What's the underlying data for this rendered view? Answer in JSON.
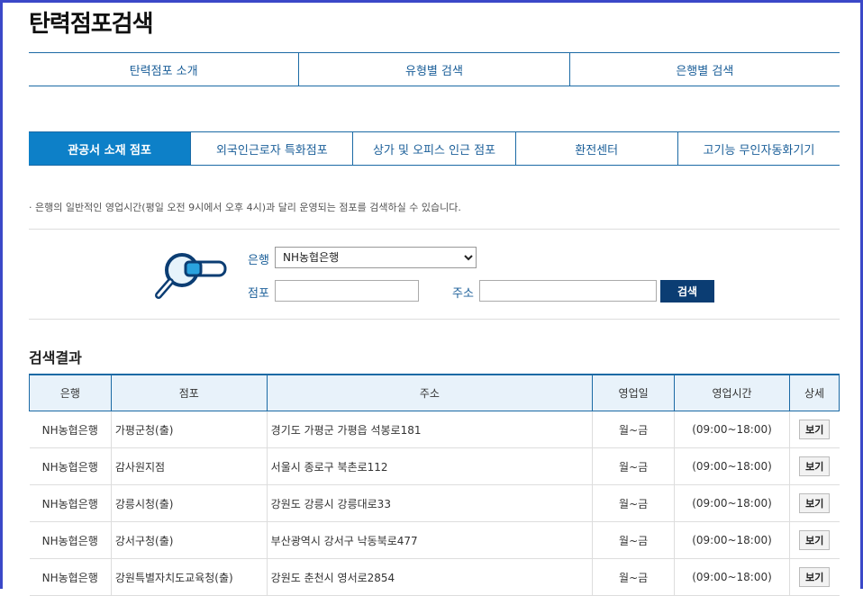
{
  "page": {
    "title": "탄력점포검색"
  },
  "topnav": [
    "탄력점포 소개",
    "유형별 검색",
    "은행별 검색"
  ],
  "tabs": [
    {
      "label": "관공서 소재 점포",
      "active": true
    },
    {
      "label": "외국인근로자 특화점포",
      "active": false
    },
    {
      "label": "상가 및 오피스 인근 점포",
      "active": false
    },
    {
      "label": "환전센터",
      "active": false
    },
    {
      "label": "고기능 무인자동화기기",
      "active": false
    }
  ],
  "notice": "· 은행의 일반적인 영업시간(평일 오전 9시에서 오후 4시)과 달리 운영되는 점포를 검색하실 수 있습니다.",
  "search": {
    "bank_label": "은행",
    "bank_selected": "NH농협은행",
    "branch_label": "점포",
    "branch_value": "",
    "address_label": "주소",
    "address_value": "",
    "button_label": "검색"
  },
  "results": {
    "title": "검색결과",
    "headers": [
      "은행",
      "점포",
      "주소",
      "영업일",
      "영업시간",
      "상세"
    ],
    "rows": [
      {
        "bank": "NH농협은행",
        "branch": "가평군청(출)",
        "address": "경기도 가평군 가평읍 석봉로181",
        "days": "월~금",
        "hours": "(09:00~18:00)",
        "detail": "보기"
      },
      {
        "bank": "NH농협은행",
        "branch": "감사원지점",
        "address": "서울시 종로구 북촌로112",
        "days": "월~금",
        "hours": "(09:00~18:00)",
        "detail": "보기"
      },
      {
        "bank": "NH농협은행",
        "branch": "강릉시청(출)",
        "address": "강원도 강릉시 강릉대로33",
        "days": "월~금",
        "hours": "(09:00~18:00)",
        "detail": "보기"
      },
      {
        "bank": "NH농협은행",
        "branch": "강서구청(출)",
        "address": "부산광역시 강서구 낙동북로477",
        "days": "월~금",
        "hours": "(09:00~18:00)",
        "detail": "보기"
      },
      {
        "bank": "NH농협은행",
        "branch": "강원특별자치도교육청(출)",
        "address": "강원도 춘천시 영서로2854",
        "days": "월~금",
        "hours": "(09:00~18:00)",
        "detail": "보기"
      }
    ]
  },
  "colors": {
    "accent": "#0d80c8",
    "nav_text": "#1b5f99",
    "button_dark": "#0b3d73",
    "frame": "#3b48c8"
  }
}
